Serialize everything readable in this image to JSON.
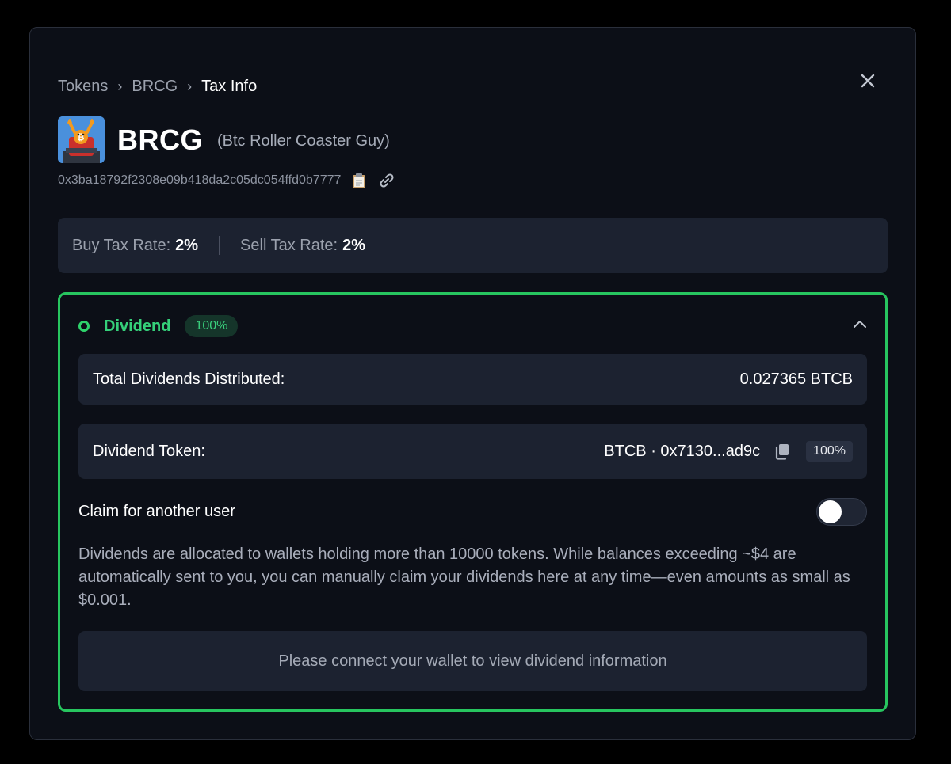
{
  "breadcrumb": {
    "items": [
      "Tokens",
      "BRCG"
    ],
    "current": "Tax Info",
    "separator": "›"
  },
  "token": {
    "symbol": "BRCG",
    "name": "(Btc Roller Coaster Guy)",
    "address": "0x3ba18792f2308e09b418da2c05dc054ffd0b7777",
    "avatar_icon": "bitcoin-roller-coaster-icon",
    "copy_icon": "clipboard-icon",
    "link_icon": "link-icon"
  },
  "tax": {
    "buy_label": "Buy Tax Rate:",
    "buy_value": "2%",
    "sell_label": "Sell Tax Rate:",
    "sell_value": "2%"
  },
  "dividend": {
    "title": "Dividend",
    "badge": "100%",
    "total_label": "Total Dividends Distributed:",
    "total_value": "0.027365 BTCB",
    "token_label": "Dividend Token:",
    "token_value": "BTCB · 0x7130...ad9c",
    "token_pct": "100%",
    "claim_label": "Claim for another user",
    "claim_enabled": false,
    "description": "Dividends are allocated to wallets holding more than 10000 tokens. While balances exceeding ~$4 are automatically sent to you, you can manually claim your dividends here at any time—even amounts as small as $0.001.",
    "connect_message": "Please connect your wallet to view dividend information"
  },
  "colors": {
    "accent_green": "#27c55f",
    "panel_bg": "#1c2230",
    "modal_bg": "#0c0f17"
  }
}
